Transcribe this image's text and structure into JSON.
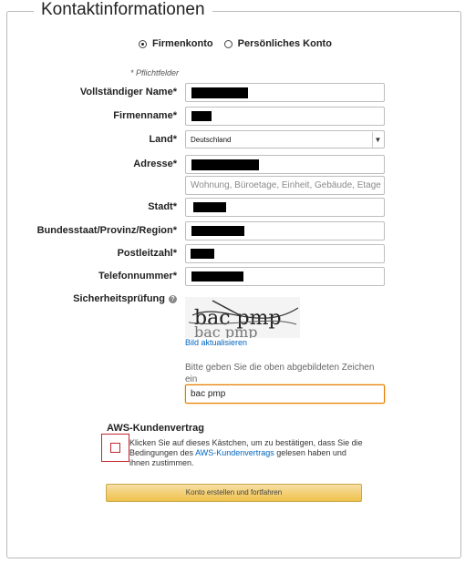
{
  "title": "Kontaktinformationen",
  "account_type": {
    "options": [
      "Firmenkonto",
      "Persönliches Konto"
    ],
    "selected": "Firmenkonto"
  },
  "required_note": "* Pflichtfelder",
  "fields": {
    "full_name": {
      "label": "Vollständiger Name*"
    },
    "company": {
      "label": "Firmenname*"
    },
    "country": {
      "label": "Land*",
      "value": "Deutschland"
    },
    "address": {
      "label": "Adresse*",
      "line2_placeholder": "Wohnung, Büroetage, Einheit, Gebäude, Etage usw"
    },
    "city": {
      "label": "Stadt*"
    },
    "state": {
      "label": "Bundesstaat/Provinz/Region*"
    },
    "postal": {
      "label": "Postleitzahl*"
    },
    "phone": {
      "label": "Telefonnummer*"
    }
  },
  "security": {
    "label": "Sicherheitsprüfung",
    "refresh_link": "Bild aktualisieren",
    "instruction": "Bitte geben Sie die oben abgebildeten Zeichen ein",
    "input_value": "bac pmp",
    "captcha_text_1": "bac pmp",
    "captcha_text_2": "bac pmp"
  },
  "agreement": {
    "title": "AWS-Kundenvertrag",
    "text_before": "Klicken Sie auf dieses Kästchen, um zu bestätigen, dass Sie die Bedingungen des ",
    "link": "AWS-Kundenvertrags",
    "text_after": " gelesen haben und ihnen zustimmen."
  },
  "submit_label": "Konto erstellen und fortfahren",
  "colors": {
    "accent": "#f0c14b",
    "link": "#0066c0",
    "highlight": "#c0262d"
  }
}
